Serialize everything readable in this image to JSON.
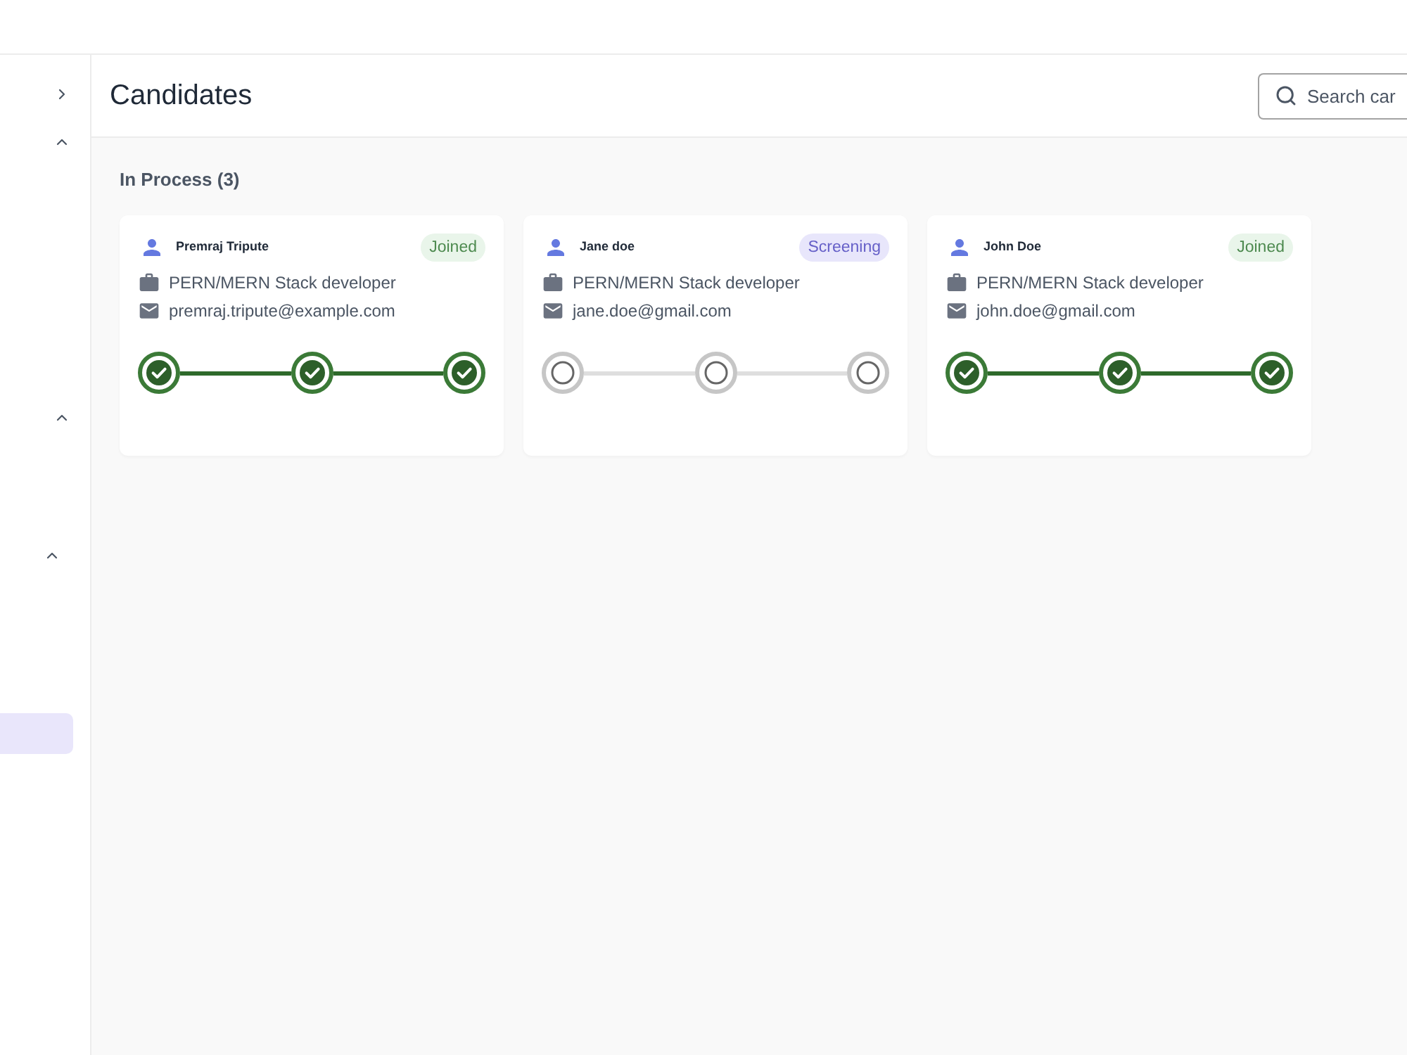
{
  "sidebar": {
    "collapsed": true,
    "groups": [
      {
        "expanded": true
      },
      {
        "expanded": true
      },
      {
        "expanded": true,
        "items": [
          {
            "selected": true
          }
        ]
      }
    ]
  },
  "header": {
    "title": "Candidates",
    "search": {
      "placeholder": "Search car"
    }
  },
  "section": {
    "title": "In Process (3)"
  },
  "candidates": [
    {
      "name": "Premraj Tripute",
      "status": {
        "label": "Joined",
        "kind": "joined"
      },
      "role": "PERN/MERN Stack developer",
      "email": "premraj.tripute@example.com",
      "steps": [
        {
          "completed": true
        },
        {
          "completed": true
        },
        {
          "completed": true
        }
      ]
    },
    {
      "name": "Jane doe",
      "status": {
        "label": "Screening",
        "kind": "screening"
      },
      "role": "PERN/MERN Stack developer",
      "email": "jane.doe@gmail.com",
      "steps": [
        {
          "completed": false
        },
        {
          "completed": false
        },
        {
          "completed": false
        }
      ]
    },
    {
      "name": "John Doe",
      "status": {
        "label": "Joined",
        "kind": "joined"
      },
      "role": "PERN/MERN Stack developer",
      "email": "john.doe@gmail.com",
      "steps": [
        {
          "completed": true
        },
        {
          "completed": true
        },
        {
          "completed": true
        }
      ]
    }
  ]
}
